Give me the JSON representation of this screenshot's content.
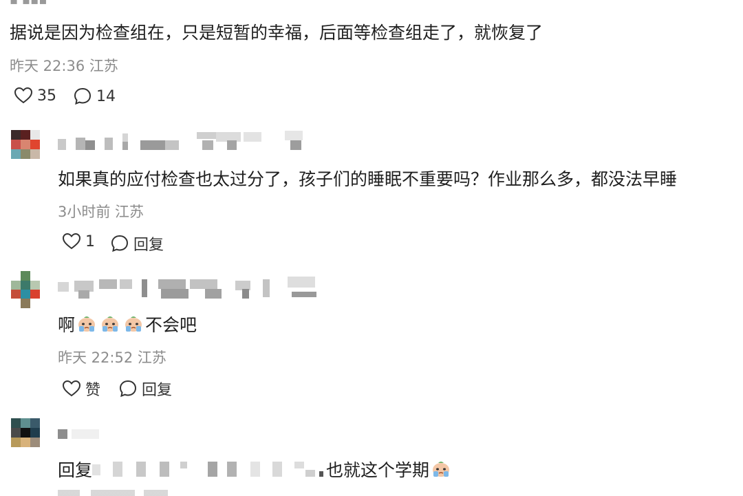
{
  "comments": [
    {
      "text": "据说是因为检查组在，只是短暂的幸福，后面等检查组走了，就恢复了",
      "meta": "昨天 22:36 江苏",
      "likes": "35",
      "replies": "14"
    },
    {
      "text": "如果真的应付检查也太过分了，孩子们的睡眠不重要吗？作业那么多，都没法早睡",
      "meta": "3小时前 江苏",
      "likes": "1",
      "reply_label": "回复"
    },
    {
      "text_prefix": "啊",
      "text_suffix": "不会吧",
      "meta": "昨天 22:52 江苏",
      "like_label": "赞",
      "reply_label": "回复"
    },
    {
      "text_prefix": "回复",
      "text_suffix": "也就这个学期"
    }
  ],
  "colors": {
    "text": "#1f1f1f",
    "meta": "#8c8c8c",
    "icon": "#333333"
  },
  "icons": [
    "heart-icon",
    "comment-bubble-icon",
    "crying-face-emoji"
  ]
}
